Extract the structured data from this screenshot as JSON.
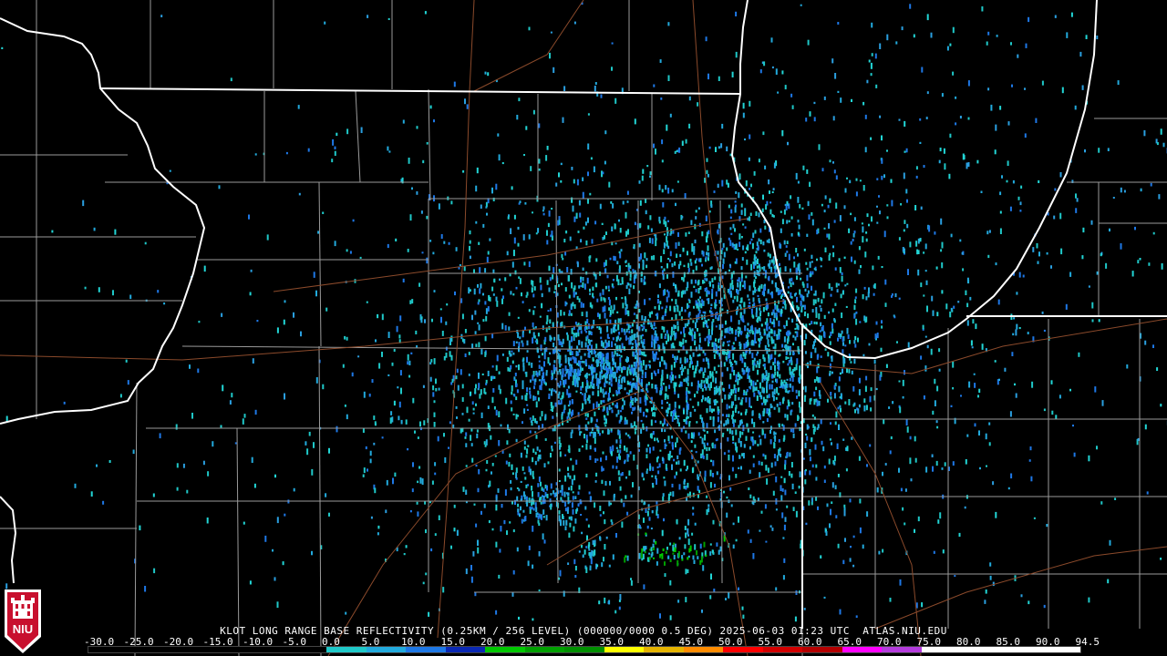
{
  "title": "KLOT LONG RANGE BASE REFLECTIVITY (0.25KM / 256 LEVEL) (000000/0000 0.5 DEG) 2025-06-03 01:23 UTC  ATLAS.NIU.EDU",
  "logo_text": "NIU",
  "logo_colors": {
    "red": "#c8102e",
    "white": "#ffffff"
  },
  "map_colors": {
    "background": "#000000",
    "state_borders": "#ffffff",
    "county_lines": "#9a9a9a",
    "highways": "#8b4a2b"
  },
  "scale": {
    "labels": [
      "-30.0",
      "-25.0",
      "-20.0",
      "-15.0",
      "-10.0",
      "-5.0",
      "0.0",
      "5.0",
      "10.0",
      "15.0",
      "20.0",
      "25.0",
      "30.0",
      "35.0",
      "40.0",
      "45.0",
      "50.0",
      "55.0",
      "60.0",
      "65.0",
      "70.0",
      "75.0",
      "80.0",
      "85.0",
      "90.0",
      "94.5"
    ],
    "colors": [
      "#000000",
      "#000000",
      "#000000",
      "#000000",
      "#000000",
      "#000000",
      "#1fc8c8",
      "#22aadd",
      "#1e78e6",
      "#0a28b4",
      "#00c800",
      "#00a000",
      "#009000",
      "#ffff00",
      "#e6b400",
      "#ff8c00",
      "#ff0000",
      "#d20000",
      "#b40000",
      "#ff00ff",
      "#b43cdc",
      "#ffffff",
      "#ffffff",
      "#ffffff",
      "#ffffff"
    ]
  }
}
